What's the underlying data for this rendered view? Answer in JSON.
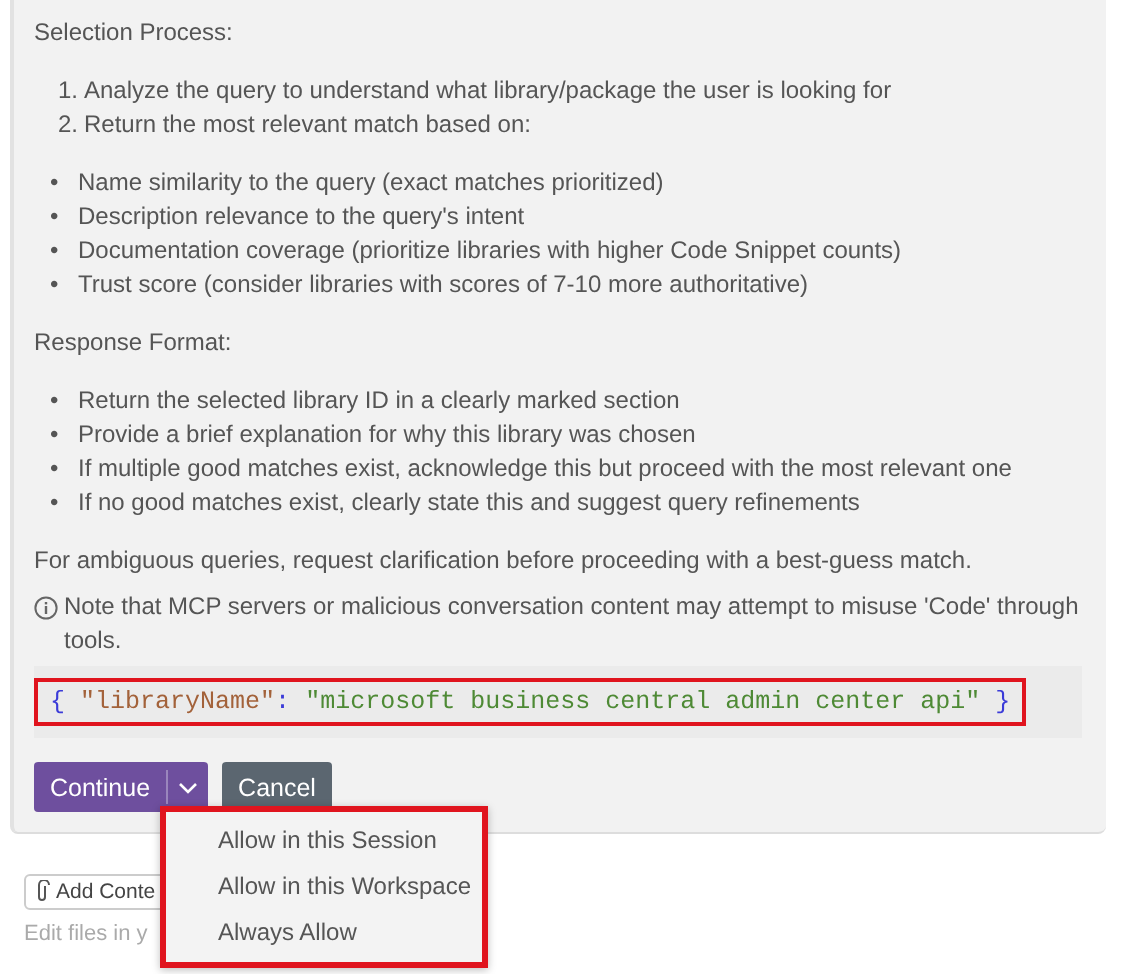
{
  "blocks": [
    {
      "kind": "heading",
      "text": "Selection Process:"
    },
    {
      "kind": "list",
      "items": [
        {
          "marker": "1.",
          "text": "Analyze the query to understand what library/package the user is looking for"
        },
        {
          "marker": "2.",
          "text": "Return the most relevant match based on:"
        }
      ]
    },
    {
      "kind": "list",
      "items": [
        {
          "marker": "•",
          "text": "Name similarity to the query (exact matches prioritized)"
        },
        {
          "marker": "•",
          "text": "Description relevance to the query's intent"
        },
        {
          "marker": "•",
          "text": "Documentation coverage (prioritize libraries with higher Code Snippet counts)"
        },
        {
          "marker": "•",
          "text": "Trust score (consider libraries with scores of 7-10 more authoritative)"
        }
      ]
    },
    {
      "kind": "heading",
      "text": "Response Format:"
    },
    {
      "kind": "list",
      "items": [
        {
          "marker": "•",
          "text": "Return the selected library ID in a clearly marked section"
        },
        {
          "marker": "•",
          "text": "Provide a brief explanation for why this library was chosen"
        },
        {
          "marker": "•",
          "text": "If multiple good matches exist, acknowledge this but proceed with the most relevant one"
        },
        {
          "marker": "•",
          "text": "If no good matches exist, clearly state this and suggest query refinements"
        }
      ]
    },
    {
      "kind": "paragraph",
      "text": "For ambiguous queries, request clarification before proceeding with a best-guess match."
    },
    {
      "kind": "note",
      "text": "Note that MCP servers or malicious conversation content may attempt to misuse 'Code' through tools."
    }
  ],
  "code": {
    "highlighted": true,
    "tokens": [
      {
        "kind": "punct",
        "text": "{ "
      },
      {
        "kind": "key",
        "text": "\"libraryName\""
      },
      {
        "kind": "punct",
        "text": ": "
      },
      {
        "kind": "string",
        "text": "\"microsoft business central admin center api\""
      },
      {
        "kind": "punct",
        "text": " }"
      }
    ]
  },
  "buttons": [
    {
      "kind": "primary",
      "label": "Continue"
    },
    {
      "kind": "secondary",
      "label": "Cancel"
    }
  ],
  "menu": {
    "highlighted": true,
    "items": [
      "Allow in this Session",
      "Allow in this Workspace",
      "Always Allow"
    ]
  },
  "chat_input": {
    "attach_label": "Add Conte",
    "placeholder": "Edit files in y"
  }
}
